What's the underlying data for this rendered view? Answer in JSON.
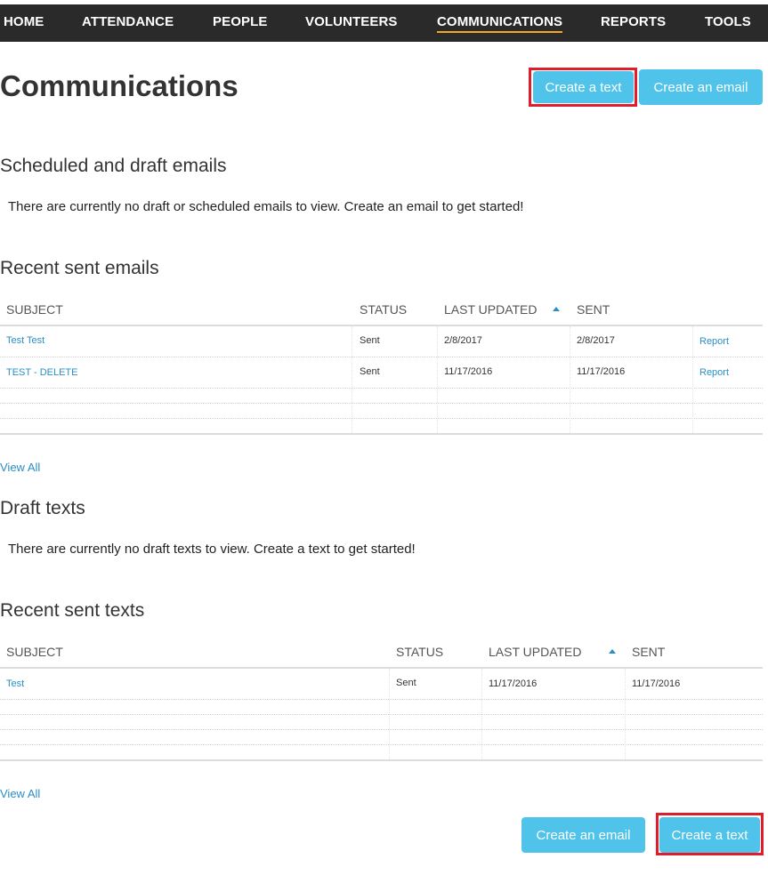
{
  "nav": {
    "items": [
      "HOME",
      "ATTENDANCE",
      "PEOPLE",
      "VOLUNTEERS",
      "COMMUNICATIONS",
      "REPORTS",
      "TOOLS"
    ],
    "active": "COMMUNICATIONS"
  },
  "header": {
    "title": "Communications",
    "create_text_label": "Create a text",
    "create_email_label": "Create an email"
  },
  "scheduled": {
    "heading": "Scheduled and draft emails",
    "empty_message": "There are currently no draft or scheduled emails to view. Create an email to get started!"
  },
  "recent_emails": {
    "heading": "Recent sent emails",
    "columns": [
      "SUBJECT",
      "STATUS",
      "LAST UPDATED",
      "SENT"
    ],
    "rows": [
      {
        "subject": "Test Test",
        "status": "Sent",
        "last_updated": "2/8/2017",
        "sent": "2/8/2017",
        "action": "Report"
      },
      {
        "subject": "TEST - DELETE",
        "status": "Sent",
        "last_updated": "11/17/2016",
        "sent": "11/17/2016",
        "action": "Report"
      }
    ],
    "view_all": "View All"
  },
  "draft_texts": {
    "heading": "Draft texts",
    "empty_message": "There are currently no draft texts to view. Create a text to get started!"
  },
  "recent_texts": {
    "heading": "Recent sent texts",
    "columns": [
      "SUBJECT",
      "STATUS",
      "LAST UPDATED",
      "SENT"
    ],
    "rows": [
      {
        "subject": "Test",
        "status": "Sent",
        "last_updated": "11/17/2016",
        "sent": "11/17/2016"
      }
    ],
    "view_all": "View All"
  },
  "footer": {
    "create_email_label": "Create an email",
    "create_text_label": "Create a text"
  },
  "colors": {
    "nav_bg": "#2a2a2a",
    "accent": "#4fc3ea",
    "link": "#2a8fc4",
    "highlight": "#e01e2b",
    "active_underline": "#f5a623"
  }
}
